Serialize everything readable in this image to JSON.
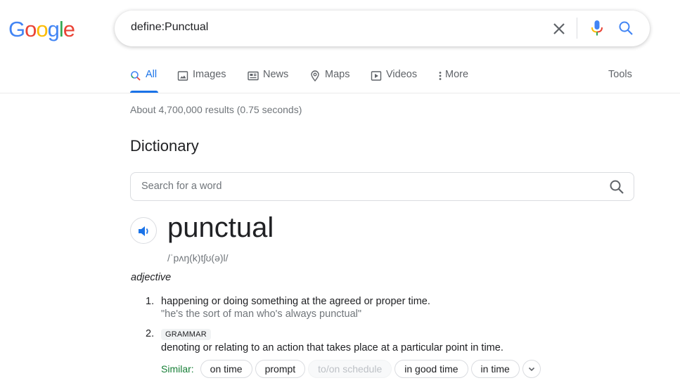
{
  "logo": {
    "letters": [
      "G",
      "o",
      "o",
      "g",
      "l",
      "e"
    ],
    "colors": [
      "#4285f4",
      "#ea4335",
      "#fbbc05",
      "#4285f4",
      "#34a853",
      "#ea4335"
    ]
  },
  "search": {
    "query": "define:Punctual",
    "clear_icon": "close-icon",
    "mic_icon": "microphone-icon",
    "search_icon": "search-icon"
  },
  "tabs": [
    {
      "label": "All",
      "icon": "search-icon",
      "active": true
    },
    {
      "label": "Images",
      "icon": "image-icon",
      "active": false
    },
    {
      "label": "News",
      "icon": "newspaper-icon",
      "active": false
    },
    {
      "label": "Maps",
      "icon": "map-pin-icon",
      "active": false
    },
    {
      "label": "Videos",
      "icon": "play-icon",
      "active": false
    },
    {
      "label": "More",
      "icon": "more-vert-icon",
      "active": false
    }
  ],
  "tools_label": "Tools",
  "result_stats": "About 4,700,000 results (0.75 seconds)",
  "dictionary": {
    "title": "Dictionary",
    "search_placeholder": "Search for a word",
    "headword": "punctual",
    "phonetic": "/ˈpʌŋ(k)tʃʊ(ə)l/",
    "part_of_speech": "adjective",
    "senses": [
      {
        "number": "1.",
        "definition": "happening or doing something at the agreed or proper time.",
        "example": "\"he's the sort of man who's always punctual\""
      },
      {
        "number": "2.",
        "label": "GRAMMAR",
        "definition": "denoting or relating to an action that takes place at a particular point in time."
      }
    ],
    "similar": {
      "label": "Similar:",
      "chips": [
        {
          "text": "on time",
          "disabled": false
        },
        {
          "text": "prompt",
          "disabled": false
        },
        {
          "text": "to/on schedule",
          "disabled": true
        },
        {
          "text": "in good time",
          "disabled": false
        },
        {
          "text": "in time",
          "disabled": false
        }
      ]
    }
  },
  "colors": {
    "accent": "#1a73e8",
    "similar_label": "#188038",
    "muted_text": "#70757a"
  }
}
